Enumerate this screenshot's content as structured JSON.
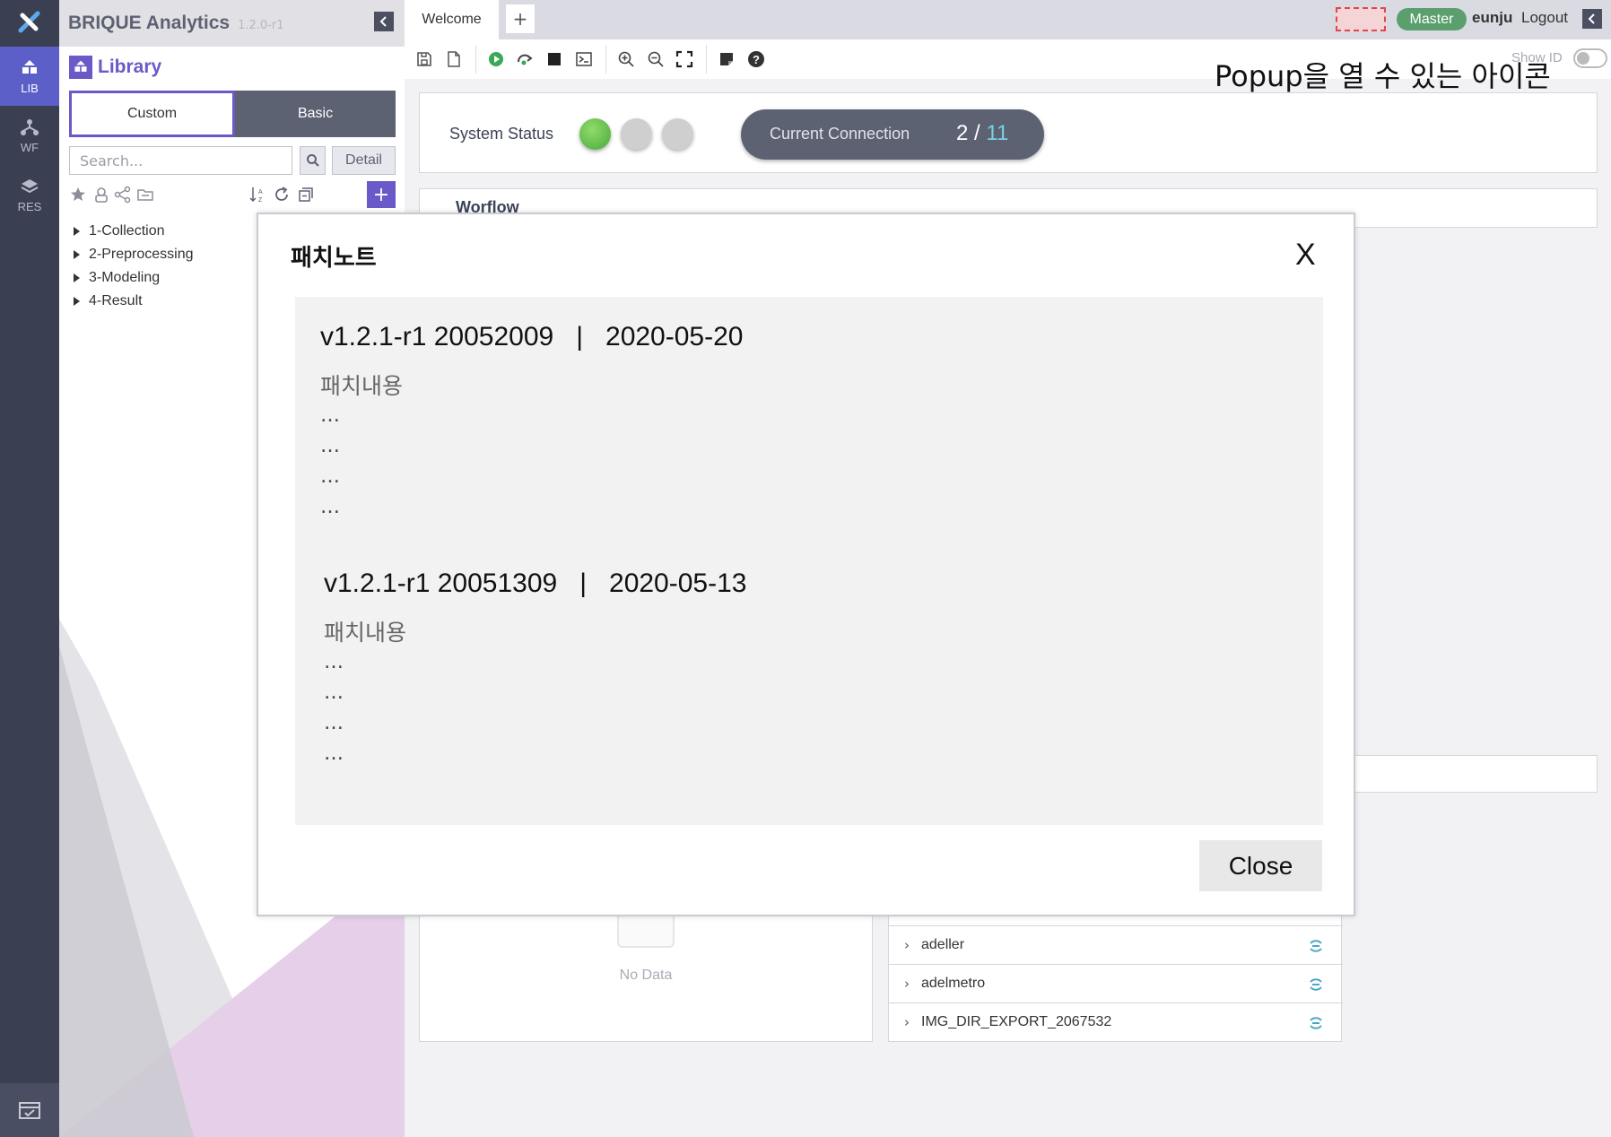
{
  "app": {
    "name": "BRIQUE Analytics",
    "version": "1.2.0-r1"
  },
  "rail": {
    "items": [
      {
        "label": "LIB",
        "icon": "library-icon",
        "active": true
      },
      {
        "label": "WF",
        "icon": "workflow-icon",
        "active": false
      },
      {
        "label": "RES",
        "icon": "resource-icon",
        "active": false
      }
    ],
    "bottom_icon": "calendar-icon"
  },
  "library": {
    "title": "Library",
    "tabs": [
      "Custom",
      "Basic"
    ],
    "active_tab": "Custom",
    "search_placeholder": "Search...",
    "detail_label": "Detail",
    "tools": [
      "star-icon",
      "user-icon",
      "share-icon",
      "folder-icon",
      "sort-az-icon",
      "refresh-icon",
      "collapse-icon"
    ],
    "add_label": "+",
    "tree": [
      "1-Collection",
      "2-Preprocessing",
      "3-Modeling",
      "4-Result"
    ]
  },
  "topbar": {
    "tab": "Welcome",
    "add_tab": "+",
    "role_badge": "Master",
    "user": "eunju",
    "logout": "Logout"
  },
  "toolbar": {
    "show_id_label": "Show ID",
    "show_id_on": false,
    "icons": [
      "save-icon",
      "new-file-icon",
      "run-icon",
      "step-run-icon",
      "stop-icon",
      "terminal-icon",
      "zoom-in-icon",
      "zoom-out-icon",
      "fit-icon",
      "note-icon",
      "help-icon"
    ]
  },
  "annotation": "Popup을 열 수 있는 아이콘",
  "status": {
    "label": "System Status",
    "dots": [
      {
        "state": "on",
        "color": "#5cb846"
      },
      {
        "state": "off",
        "color": "#cfcfcf"
      },
      {
        "state": "off",
        "color": "#cfcfcf"
      }
    ],
    "connection_label": "Current Connection",
    "connection_current": "2",
    "connection_separator": " / ",
    "connection_max": "11"
  },
  "workflow": {
    "title": "Worflow"
  },
  "nodata": "No Data",
  "list": [
    "adeller",
    "adelmetro",
    "IMG_DIR_EXPORT_2067532"
  ],
  "modal": {
    "title": "패치노트",
    "close_x": "X",
    "notes": [
      {
        "header": "v1.2.1-r1 20052009   |   2020-05-20",
        "desc": "패치내용",
        "lines": [
          "…",
          "…",
          "…",
          "…"
        ]
      },
      {
        "header": "v1.2.1-r1 20051309   |   2020-05-13",
        "desc": "패치내용",
        "lines": [
          "…",
          "…",
          "…",
          "…"
        ]
      }
    ],
    "close_label": "Close"
  },
  "colors": {
    "accent": "#6a59c8",
    "rail": "#3b3f52",
    "master_badge": "#5b9f6e",
    "connection_pill": "#5d6272",
    "connection_max": "#78d2e6"
  }
}
